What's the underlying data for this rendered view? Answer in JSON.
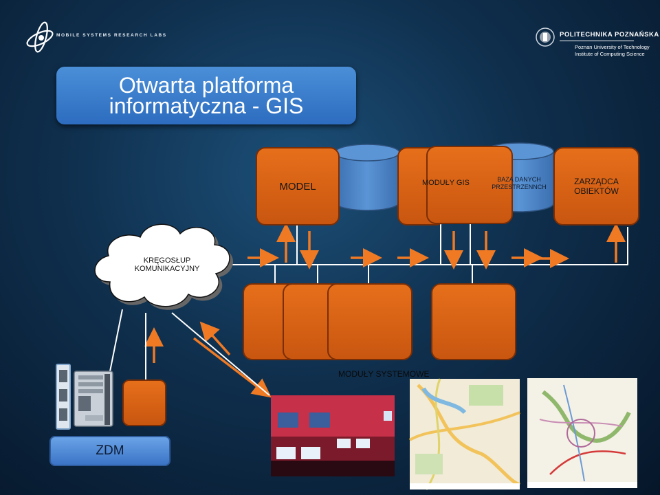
{
  "header": {
    "lab_name": "MOBILE SYSTEMS RESEARCH LABS",
    "university_name": "POLITECHNIKA POZNAŃSKA",
    "university_en": "Poznan University of Technology",
    "institute": "Institute of Computing Science"
  },
  "title": {
    "line1": "Otwarta platforma",
    "line2": "informatyczna - GIS"
  },
  "nodes": {
    "model": "MODEL",
    "gis_modules": "MODUŁY GIS",
    "spatial_db_line1": "BAZA DANYCH",
    "spatial_db_line2": "PRZESTRZENNCH",
    "object_manager_line1": "ZARZĄDCA",
    "object_manager_line2": "OBIEKTÓW",
    "backbone_line1": "KRĘGOSŁUP",
    "backbone_line2": "KOMUNIKACYJNY",
    "system_modules": "MODUŁY SYSTEMOWE",
    "zdm": "ZDM"
  },
  "colors": {
    "module_orange": "#e0661a",
    "title_blue": "#3a7ccc",
    "cylinder_blue": "#4a84c8",
    "arrow_orange": "#f07a24",
    "bus_white": "#ffffff"
  }
}
